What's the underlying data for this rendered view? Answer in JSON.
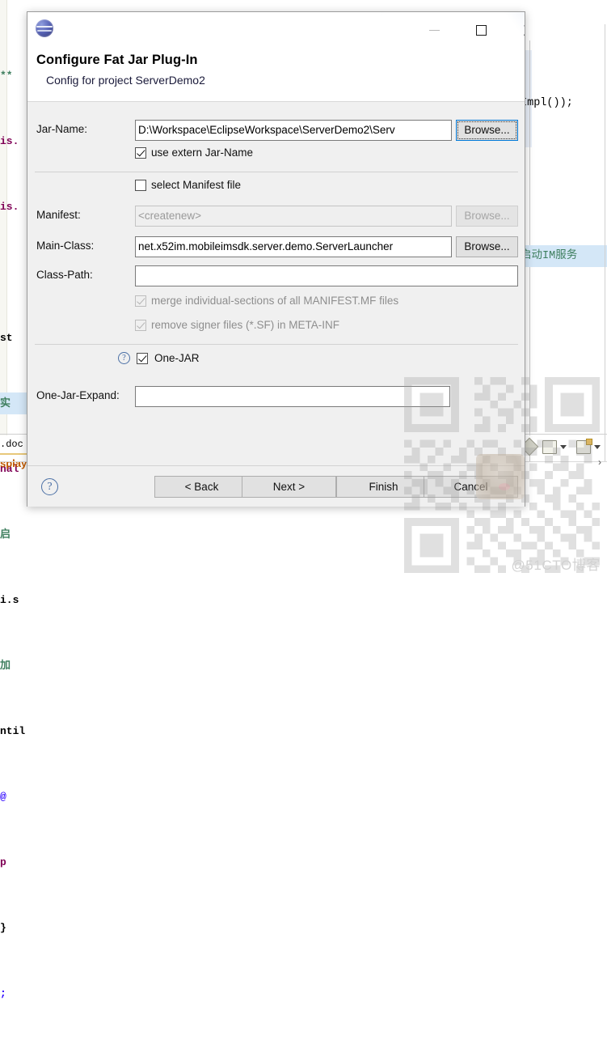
{
  "background": {
    "code_left": [
      {
        "text": "**",
        "color": "green"
      },
      {
        "text": "is.",
        "color": "purple"
      },
      {
        "text": "is.",
        "color": "purple"
      },
      {
        "text": "",
        "color": "black"
      },
      {
        "text": "st",
        "color": "black"
      },
      {
        "text": "实",
        "color": "green",
        "selected": true
      },
      {
        "text": "nal",
        "color": "purple"
      },
      {
        "text": "启",
        "color": "green"
      },
      {
        "text": "i.s",
        "color": "black"
      },
      {
        "text": "加",
        "color": "green"
      },
      {
        "text": "ntil",
        "color": "black"
      },
      {
        "text": "@",
        "color": "blue"
      },
      {
        "text": "p",
        "color": "purple"
      },
      {
        "text": "}",
        "color": "black"
      },
      {
        "text": ";",
        "color": "blue"
      }
    ],
    "code_right_line": "Impl());",
    "code_right_comment": "启动IM服务",
    "tab_doc_label": ".doc",
    "tab_splay_label": "splay"
  },
  "dialog": {
    "app_icon": "eclipse-globe-icon",
    "title": "Configure Fat Jar Plug-In",
    "subtitle": "Config for project ServerDemo2",
    "window_controls": {
      "minimize": "minimize-icon",
      "maximize": "maximize-icon",
      "close": "close-icon"
    },
    "fields": {
      "jar_name": {
        "label": "Jar-Name:",
        "value": "D:\\Workspace\\EclipseWorkspace\\ServerDemo2\\Serv",
        "browse_label": "Browse..."
      },
      "use_extern_jar_name": {
        "label": "use extern Jar-Name",
        "checked": true
      },
      "select_manifest_file": {
        "label": "select Manifest file",
        "checked": false
      },
      "manifest": {
        "label": "Manifest:",
        "value": "<createnew>",
        "browse_label": "Browse...",
        "disabled": true
      },
      "main_class": {
        "label": "Main-Class:",
        "value": "net.x52im.mobileimsdk.server.demo.ServerLauncher",
        "browse_label": "Browse..."
      },
      "class_path": {
        "label": "Class-Path:",
        "value": ""
      },
      "merge_individual_sections": {
        "label": "merge individual-sections of all MANIFEST.MF files",
        "checked": true,
        "disabled": true
      },
      "remove_signer_files": {
        "label": "remove signer files (*.SF) in META-INF",
        "checked": true,
        "disabled": true
      },
      "one_jar": {
        "label": "One-JAR",
        "checked": true,
        "help": "?"
      },
      "one_jar_expand": {
        "label": "One-Jar-Expand:",
        "value": ""
      }
    },
    "footer": {
      "help": "?",
      "back": "< Back",
      "next": "Next >",
      "finish": "Finish",
      "cancel": "Cancel"
    }
  },
  "watermark": {
    "site": "@51CTO博客",
    "qr": "qr-code-icon",
    "photo": "avatar-photo"
  },
  "colors": {
    "accent": "#0078d7",
    "dialog_bg": "#f0f0f0",
    "field_border": "#7a7a7a",
    "link": "#4a6fa5"
  }
}
